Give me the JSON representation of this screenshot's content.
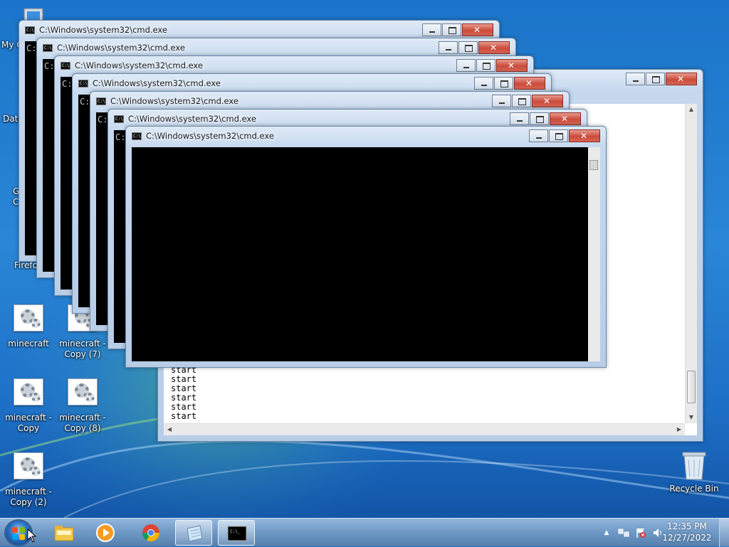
{
  "desktop": {
    "icons": [
      {
        "label": "My Computer",
        "shown": "My Comp"
      },
      {
        "label": "DataWagon",
        "shown": "DataWagon..."
      },
      {
        "label": "Google Chrome",
        "line1": "Google",
        "line2": "Chrome"
      },
      {
        "label": "Firefox",
        "shown": "Firefo"
      },
      {
        "label": "minecraft",
        "line1": "minecraft",
        "line2": ""
      },
      {
        "label": "minecraft - Copy (7)",
        "line1": "minecraft -",
        "line2": "Copy (7)"
      },
      {
        "label": "minecraft - Copy",
        "line1": "minecraft -",
        "line2": "Copy"
      },
      {
        "label": "minecraft - Copy (8)",
        "line1": "minecraft -",
        "line2": "Copy (8)"
      },
      {
        "label": "minecraft - Copy (2)",
        "line1": "minecraft -",
        "line2": "Copy (2)"
      },
      {
        "label": "Recycle Bin",
        "line1": "Recycle Bin"
      }
    ],
    "partial_labels": [
      "mi",
      "C",
      "mi",
      "C",
      "mi",
      "C"
    ]
  },
  "cmd_windows": [
    {
      "title": "C:\\Windows\\system32\\cmd.exe",
      "prompt": "C:"
    },
    {
      "title": "C:\\Windows\\system32\\cmd.exe",
      "prompt": "C:"
    },
    {
      "title": "C:\\Windows\\system32\\cmd.exe",
      "prompt": "C:"
    },
    {
      "title": "C:\\Windows\\system32\\cmd.exe",
      "prompt": "C:"
    },
    {
      "title": "C:\\Windows\\system32\\cmd.exe",
      "prompt": "C:"
    },
    {
      "title": "C:\\Windows\\system32\\cmd.exe",
      "prompt": "C:"
    },
    {
      "title": "C:\\Windows\\system32\\cmd.exe",
      "prompt": ""
    }
  ],
  "notepad": {
    "lines": [
      "start",
      "start",
      "start",
      "start",
      "start",
      "start",
      "start",
      "start"
    ]
  },
  "taskbar": {
    "clock_time": "12:35 PM",
    "clock_date": "12/27/2022",
    "tray_expand": "▲",
    "buttons": [
      {
        "name": "windows-explorer",
        "active": false
      },
      {
        "name": "windows-media-player",
        "active": false
      },
      {
        "name": "google-chrome",
        "active": false
      },
      {
        "name": "notepad",
        "active": true
      },
      {
        "name": "command-prompt",
        "active": true
      }
    ]
  },
  "colors": {
    "accent": "#1b74c9",
    "close_button": "#c94b3b",
    "console_bg": "#000000"
  }
}
